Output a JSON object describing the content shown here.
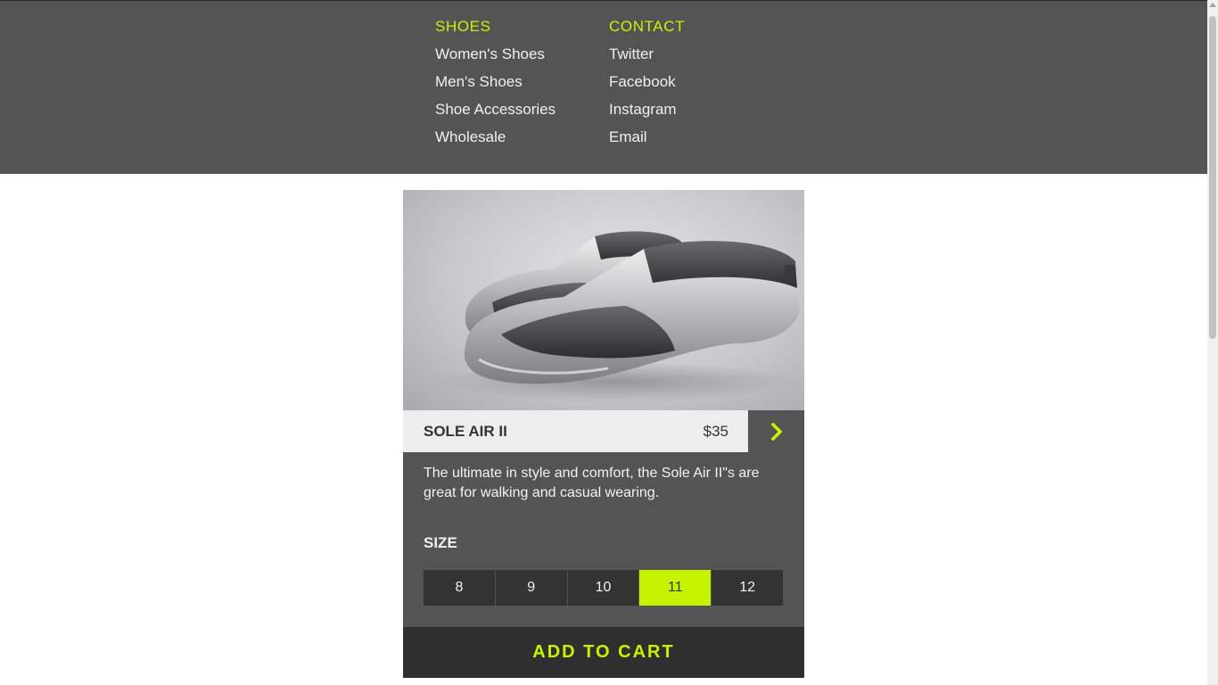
{
  "nav": {
    "shoes": {
      "heading": "SHOES",
      "links": [
        "Women's Shoes",
        "Men's Shoes",
        "Shoe Accessories",
        "Wholesale"
      ]
    },
    "contact": {
      "heading": "CONTACT",
      "links": [
        "Twitter",
        "Facebook",
        "Instagram",
        "Email"
      ]
    }
  },
  "product": {
    "name": "SOLE AIR II",
    "price": "$35",
    "description": "The ultimate in style and comfort, the Sole Air II\"s are great for walking and casual wearing.",
    "size_label": "SIZE",
    "sizes": [
      "8",
      "9",
      "10",
      "11",
      "12"
    ],
    "selected_size": "11",
    "add_to_cart": "ADD TO CART",
    "image_icon": "shoe-product-image",
    "next_icon": "chevron-right-icon"
  },
  "colors": {
    "accent": "#c6f400",
    "nav_bg": "#545454",
    "dark": "#2f2f2f",
    "info_bg": "#ededed"
  }
}
